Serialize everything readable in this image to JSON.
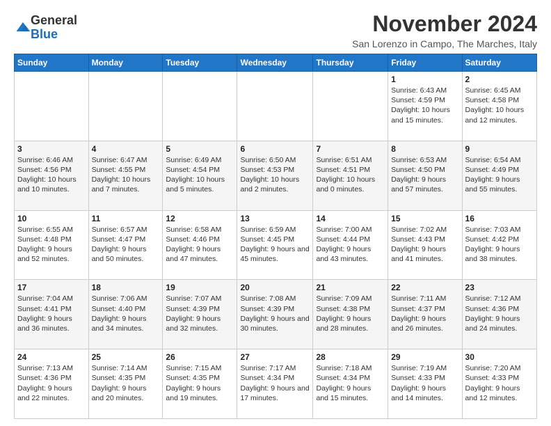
{
  "logo": {
    "general": "General",
    "blue": "Blue"
  },
  "header": {
    "month": "November 2024",
    "location": "San Lorenzo in Campo, The Marches, Italy"
  },
  "days_of_week": [
    "Sunday",
    "Monday",
    "Tuesday",
    "Wednesday",
    "Thursday",
    "Friday",
    "Saturday"
  ],
  "weeks": [
    [
      {
        "day": "",
        "info": ""
      },
      {
        "day": "",
        "info": ""
      },
      {
        "day": "",
        "info": ""
      },
      {
        "day": "",
        "info": ""
      },
      {
        "day": "",
        "info": ""
      },
      {
        "day": "1",
        "info": "Sunrise: 6:43 AM\nSunset: 4:59 PM\nDaylight: 10 hours and 15 minutes."
      },
      {
        "day": "2",
        "info": "Sunrise: 6:45 AM\nSunset: 4:58 PM\nDaylight: 10 hours and 12 minutes."
      }
    ],
    [
      {
        "day": "3",
        "info": "Sunrise: 6:46 AM\nSunset: 4:56 PM\nDaylight: 10 hours and 10 minutes."
      },
      {
        "day": "4",
        "info": "Sunrise: 6:47 AM\nSunset: 4:55 PM\nDaylight: 10 hours and 7 minutes."
      },
      {
        "day": "5",
        "info": "Sunrise: 6:49 AM\nSunset: 4:54 PM\nDaylight: 10 hours and 5 minutes."
      },
      {
        "day": "6",
        "info": "Sunrise: 6:50 AM\nSunset: 4:53 PM\nDaylight: 10 hours and 2 minutes."
      },
      {
        "day": "7",
        "info": "Sunrise: 6:51 AM\nSunset: 4:51 PM\nDaylight: 10 hours and 0 minutes."
      },
      {
        "day": "8",
        "info": "Sunrise: 6:53 AM\nSunset: 4:50 PM\nDaylight: 9 hours and 57 minutes."
      },
      {
        "day": "9",
        "info": "Sunrise: 6:54 AM\nSunset: 4:49 PM\nDaylight: 9 hours and 55 minutes."
      }
    ],
    [
      {
        "day": "10",
        "info": "Sunrise: 6:55 AM\nSunset: 4:48 PM\nDaylight: 9 hours and 52 minutes."
      },
      {
        "day": "11",
        "info": "Sunrise: 6:57 AM\nSunset: 4:47 PM\nDaylight: 9 hours and 50 minutes."
      },
      {
        "day": "12",
        "info": "Sunrise: 6:58 AM\nSunset: 4:46 PM\nDaylight: 9 hours and 47 minutes."
      },
      {
        "day": "13",
        "info": "Sunrise: 6:59 AM\nSunset: 4:45 PM\nDaylight: 9 hours and 45 minutes."
      },
      {
        "day": "14",
        "info": "Sunrise: 7:00 AM\nSunset: 4:44 PM\nDaylight: 9 hours and 43 minutes."
      },
      {
        "day": "15",
        "info": "Sunrise: 7:02 AM\nSunset: 4:43 PM\nDaylight: 9 hours and 41 minutes."
      },
      {
        "day": "16",
        "info": "Sunrise: 7:03 AM\nSunset: 4:42 PM\nDaylight: 9 hours and 38 minutes."
      }
    ],
    [
      {
        "day": "17",
        "info": "Sunrise: 7:04 AM\nSunset: 4:41 PM\nDaylight: 9 hours and 36 minutes."
      },
      {
        "day": "18",
        "info": "Sunrise: 7:06 AM\nSunset: 4:40 PM\nDaylight: 9 hours and 34 minutes."
      },
      {
        "day": "19",
        "info": "Sunrise: 7:07 AM\nSunset: 4:39 PM\nDaylight: 9 hours and 32 minutes."
      },
      {
        "day": "20",
        "info": "Sunrise: 7:08 AM\nSunset: 4:39 PM\nDaylight: 9 hours and 30 minutes."
      },
      {
        "day": "21",
        "info": "Sunrise: 7:09 AM\nSunset: 4:38 PM\nDaylight: 9 hours and 28 minutes."
      },
      {
        "day": "22",
        "info": "Sunrise: 7:11 AM\nSunset: 4:37 PM\nDaylight: 9 hours and 26 minutes."
      },
      {
        "day": "23",
        "info": "Sunrise: 7:12 AM\nSunset: 4:36 PM\nDaylight: 9 hours and 24 minutes."
      }
    ],
    [
      {
        "day": "24",
        "info": "Sunrise: 7:13 AM\nSunset: 4:36 PM\nDaylight: 9 hours and 22 minutes."
      },
      {
        "day": "25",
        "info": "Sunrise: 7:14 AM\nSunset: 4:35 PM\nDaylight: 9 hours and 20 minutes."
      },
      {
        "day": "26",
        "info": "Sunrise: 7:15 AM\nSunset: 4:35 PM\nDaylight: 9 hours and 19 minutes."
      },
      {
        "day": "27",
        "info": "Sunrise: 7:17 AM\nSunset: 4:34 PM\nDaylight: 9 hours and 17 minutes."
      },
      {
        "day": "28",
        "info": "Sunrise: 7:18 AM\nSunset: 4:34 PM\nDaylight: 9 hours and 15 minutes."
      },
      {
        "day": "29",
        "info": "Sunrise: 7:19 AM\nSunset: 4:33 PM\nDaylight: 9 hours and 14 minutes."
      },
      {
        "day": "30",
        "info": "Sunrise: 7:20 AM\nSunset: 4:33 PM\nDaylight: 9 hours and 12 minutes."
      }
    ]
  ]
}
